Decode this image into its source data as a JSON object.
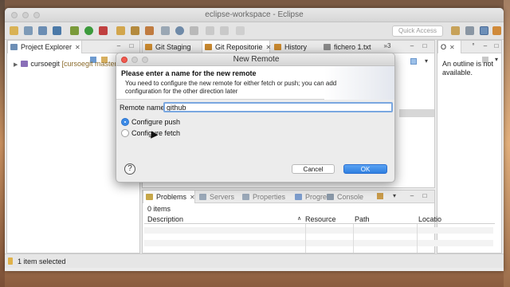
{
  "window": {
    "title": "eclipse-workspace - Eclipse",
    "quick_access": "Quick Access"
  },
  "left_panel": {
    "tab": "Project Explorer",
    "tree": {
      "project": "cursoegit",
      "repo": "[cursoegit master]"
    }
  },
  "center_tabs": [
    {
      "label": "Git Staging",
      "color": "#c9892f"
    },
    {
      "label": "Git Repositorie",
      "color": "#c9892f"
    },
    {
      "label": "History",
      "color": "#c9892f"
    },
    {
      "label": "fichero 1.txt",
      "color": "#8a8a8a"
    }
  ],
  "center_overflow": "»3",
  "right_panel": {
    "tab": "O",
    "tab_extra": "°",
    "message": "An outline is not available."
  },
  "bottom_panel": {
    "tabs": [
      "Problems",
      "Servers",
      "Properties",
      "Progress",
      "Console"
    ],
    "summary": "0 items",
    "columns": [
      "Description",
      "Resource",
      "Path",
      "Locatio"
    ]
  },
  "status": {
    "text": "1 item selected"
  },
  "dialog": {
    "title": "New Remote",
    "header_title": "Please enter a name for the new remote",
    "header_message": "You need to configure the new remote for either fetch or push; you can add configuration for the other direction later",
    "remote_name_label": "Remote name:",
    "remote_name_value": "github",
    "options": [
      {
        "label": "Configure push",
        "selected": true
      },
      {
        "label": "Configure fetch",
        "selected": false
      }
    ],
    "cancel": "Cancel",
    "ok": "OK",
    "help": "?"
  },
  "colors": {
    "accent": "#3d8be6",
    "ok_button": "#2f7fe0",
    "close_red": "#f05a50"
  }
}
